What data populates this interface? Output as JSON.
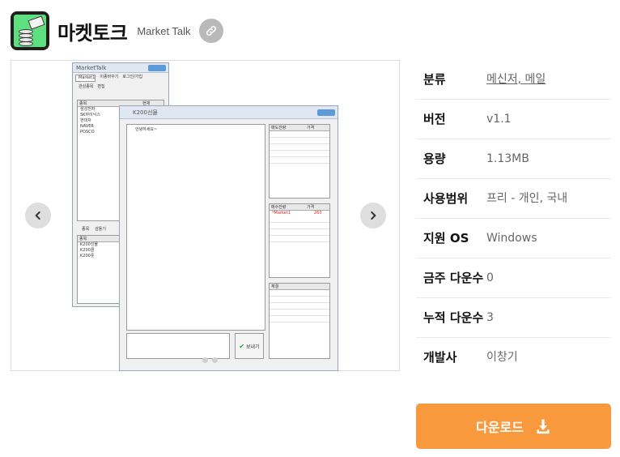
{
  "header": {
    "title": "마켓토크",
    "subtitle": "Market Talk",
    "link_icon": "link-icon"
  },
  "gallery": {
    "prev_icon": "chevron-left-icon",
    "next_icon": "chevron-right-icon",
    "screenshot": {
      "left_window": {
        "title": "MarketTalk",
        "tabs": [
          "Market1",
          "이종바꾸기",
          "로그인/가입"
        ],
        "section1_buttons": [
          "관심종목",
          "편집"
        ],
        "table1_headers": [
          "종목",
          "현재"
        ],
        "table1_rows": [
          "삼성전자",
          "SK하이닉스",
          "현대차",
          "NAVER",
          "POSCO"
        ],
        "section2_buttons": [
          "종목",
          "감들기"
        ],
        "table2_header": "종목",
        "table2_rows": [
          "K200선물",
          "K200콜",
          "K200풋"
        ]
      },
      "right_window": {
        "title": "K200선물",
        "chat_text": "안녕하세요~",
        "sell_headers": [
          "매도잔량",
          "가격"
        ],
        "buy_headers": [
          "매수잔량",
          "가격"
        ],
        "buy_row": [
          "*Market1",
          "260"
        ],
        "trade_header": "체결",
        "send_label": "보내기"
      }
    }
  },
  "info": [
    {
      "label": "분류",
      "value": "메신저, 메일",
      "link": true
    },
    {
      "label": "버전",
      "value": "v1.1",
      "link": false
    },
    {
      "label": "용량",
      "value": "1.13MB",
      "link": false
    },
    {
      "label": "사용범위",
      "value": "프리 - 개인, 국내",
      "link": false
    },
    {
      "label": "지원 OS",
      "value": "Windows",
      "link": false
    },
    {
      "label": "금주 다운수",
      "value": "0",
      "link": false
    },
    {
      "label": "누적 다운수",
      "value": "3",
      "link": false
    },
    {
      "label": "개발사",
      "value": "이창기",
      "link": false
    }
  ],
  "download": {
    "label": "다운로드",
    "icon": "download-icon"
  },
  "colors": {
    "download_button": "#f7993c",
    "link_button": "#b9b9b9",
    "app_icon_green": "#5fe07f"
  }
}
